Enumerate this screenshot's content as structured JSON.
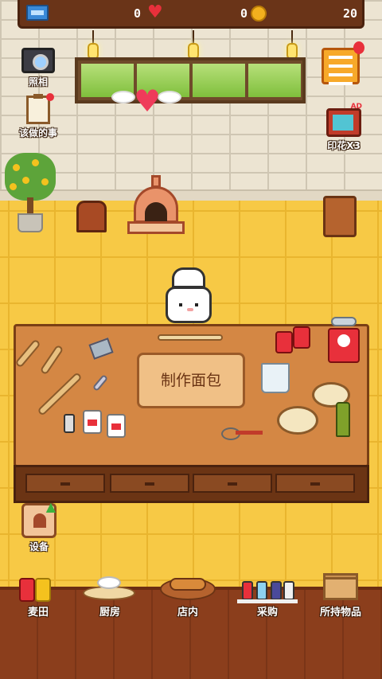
{
  "hud": {
    "tickets": "0",
    "hearts": "0",
    "coins": "20"
  },
  "side": {
    "photo_label": "照相",
    "todo_label": "该做的事",
    "stamp_label": "印花X3",
    "ad_badge": "AD"
  },
  "workbench": {
    "bake_label": "制作面包"
  },
  "equipment": {
    "label": "设备"
  },
  "nav": {
    "items": [
      {
        "label": "麦田"
      },
      {
        "label": "厨房"
      },
      {
        "label": "店内"
      },
      {
        "label": "采购"
      },
      {
        "label": "所持物品"
      }
    ]
  },
  "colors": {
    "wall": "#ece4d2",
    "floor": "#f7c945",
    "table": "#d48744",
    "topbar": "#6a3418",
    "accent_red": "#e8303b"
  }
}
